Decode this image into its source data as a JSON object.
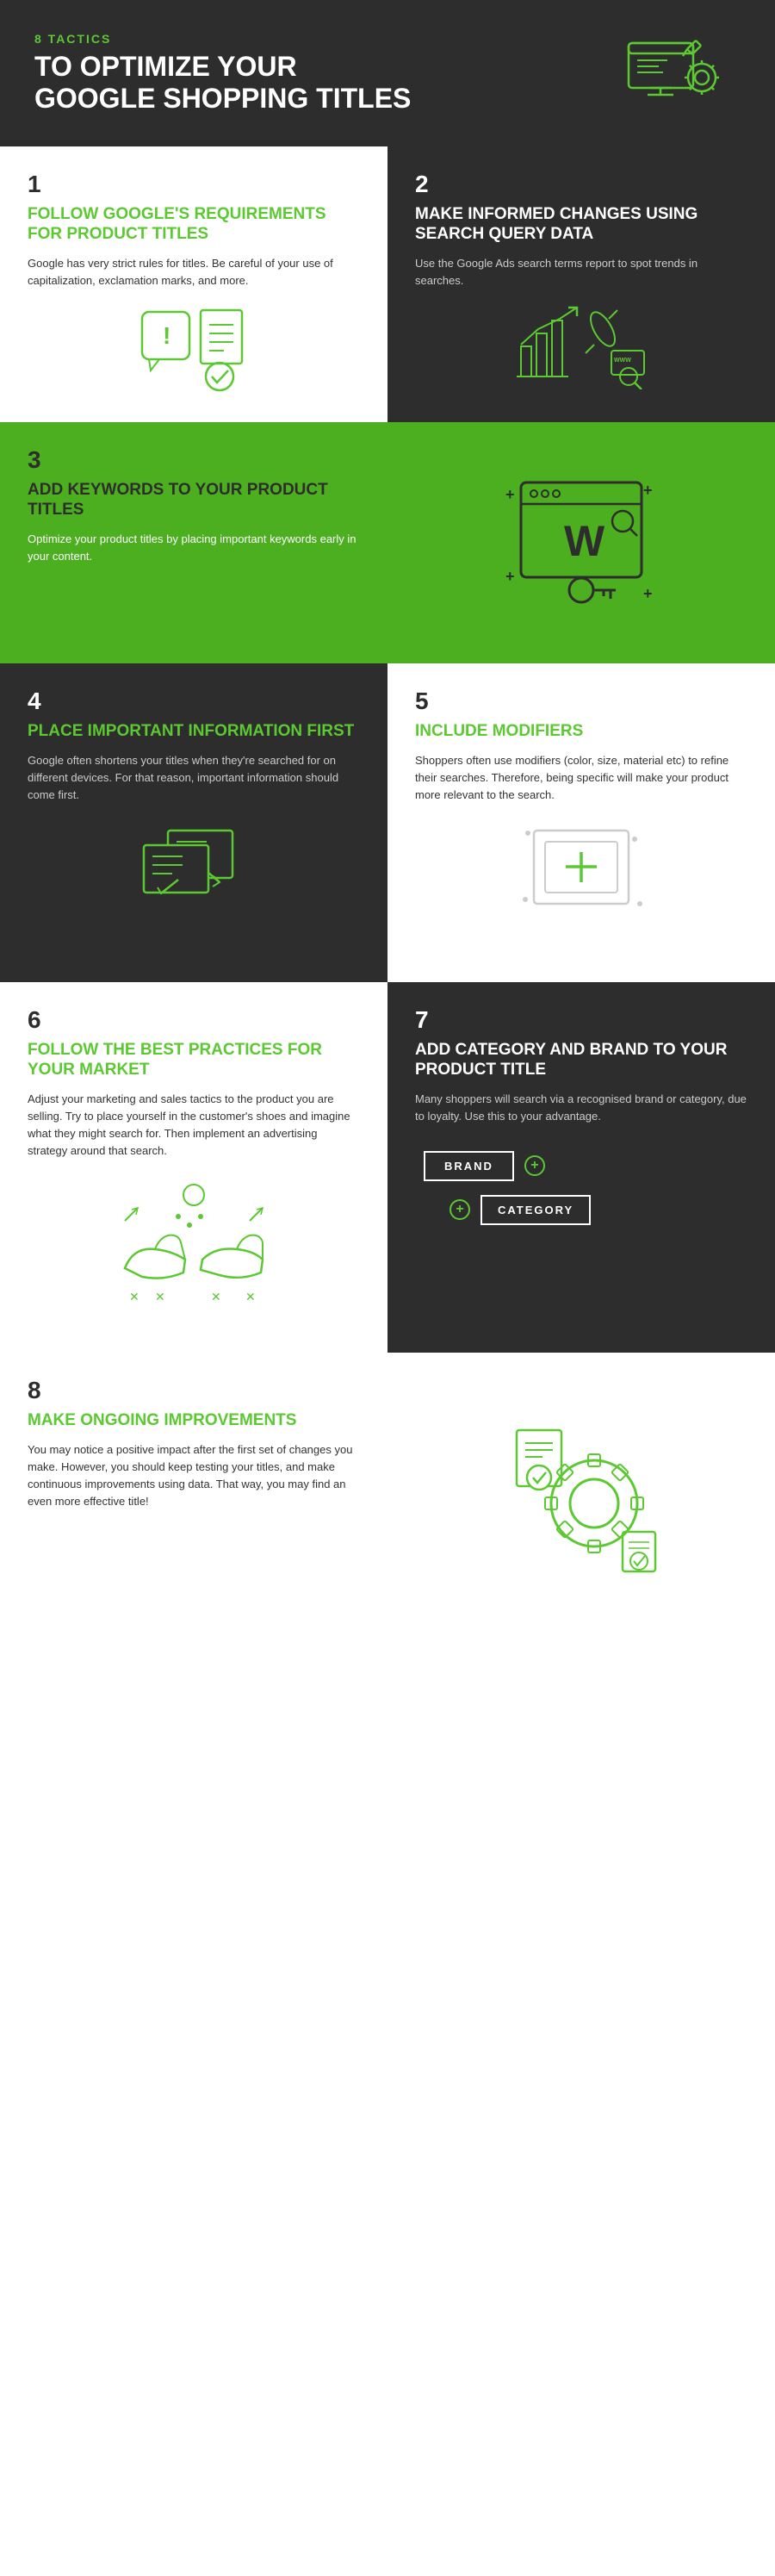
{
  "header": {
    "subtitle": "8 TACTICS",
    "title_line1": "TO OPTIMIZE YOUR",
    "title_line2": "GOOGLE SHOPPING TITLES"
  },
  "sections": [
    {
      "id": "s1",
      "number": "1",
      "title": "FOLLOW GOOGLE'S REQUIREMENTS FOR PRODUCT TITLES",
      "body": "Google has very strict rules for titles. Be careful of your use of capitalization, exclamation marks, and more.",
      "bg": "white",
      "number_color": "dark",
      "title_color": "green",
      "body_color": "dark"
    },
    {
      "id": "s2",
      "number": "2",
      "title": "MAKE INFORMED CHANGES USING SEARCH QUERY DATA",
      "body": "Use the Google Ads search terms report to spot trends in searches.",
      "bg": "dark",
      "number_color": "light",
      "title_color": "white",
      "body_color": "light"
    },
    {
      "id": "s3",
      "number": "3",
      "title": "ADD KEYWORDS TO YOUR PRODUCT TITLES",
      "body": "Optimize your product titles by placing important keywords early in your content.",
      "bg": "green",
      "number_color": "dark",
      "title_color": "dark",
      "body_color": "white"
    },
    {
      "id": "s4",
      "number": "4",
      "title": "PLACE IMPORTANT INFORMATION FIRST",
      "body": "Google often shortens your titles when they're searched for on different devices. For that reason, important information should come first.",
      "bg": "dark",
      "number_color": "light",
      "title_color": "green",
      "body_color": "light"
    },
    {
      "id": "s5",
      "number": "5",
      "title": "INCLUDE MODIFIERS",
      "body": "Shoppers often use modifiers (color, size, material etc) to refine their searches. Therefore, being specific will make your product more relevant to the search.",
      "bg": "white",
      "number_color": "dark",
      "title_color": "green",
      "body_color": "dark"
    },
    {
      "id": "s6",
      "number": "6",
      "title": "FOLLOW THE BEST PRACTICES FOR YOUR MARKET",
      "body": "Adjust your marketing and sales tactics to the product you are selling. Try to place yourself in the customer's shoes and imagine what they might search for. Then implement an advertising strategy around that search.",
      "bg": "white",
      "number_color": "dark",
      "title_color": "green",
      "body_color": "dark"
    },
    {
      "id": "s7",
      "number": "7",
      "title": "ADD CATEGORY AND BRAND TO YOUR PRODUCT TITLE",
      "body": "Many shoppers will search via a recognised brand or category, due to loyalty. Use this to your advantage.",
      "bg": "dark",
      "number_color": "light",
      "title_color": "white",
      "body_color": "light",
      "badges": [
        "BRAND",
        "CATEGORY"
      ]
    },
    {
      "id": "s8",
      "number": "8",
      "title": "MAKE ONGOING IMPROVEMENTS",
      "body": "You may notice a positive impact after the first set of changes you make. However, you should keep testing your titles, and make continuous improvements using data. That way, you may find an even more effective title!",
      "bg": "white",
      "number_color": "dark",
      "title_color": "green",
      "body_color": "dark"
    }
  ]
}
